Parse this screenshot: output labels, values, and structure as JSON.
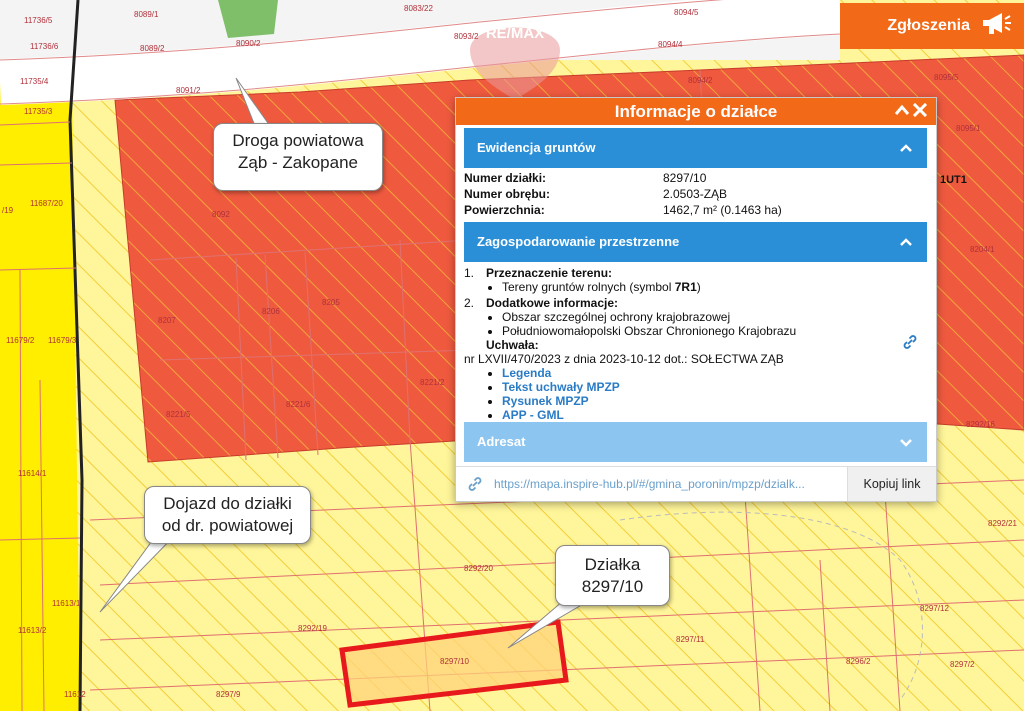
{
  "map": {
    "parcels": [
      {
        "label": "11736/5"
      },
      {
        "label": "11736/6"
      },
      {
        "label": "11735/4"
      },
      {
        "label": "11735/3"
      },
      {
        "label": "11687/20"
      },
      {
        "label": "11679/2"
      },
      {
        "label": "11679/3"
      },
      {
        "label": "11614/1"
      },
      {
        "label": "11613/1"
      },
      {
        "label": "11613/2"
      },
      {
        "label": "11612"
      },
      {
        "label": "/19"
      },
      {
        "label": "8089/1"
      },
      {
        "label": "8089/2"
      },
      {
        "label": "8090/2"
      },
      {
        "label": "8083/22"
      },
      {
        "label": "8093/2"
      },
      {
        "label": "8094/5"
      },
      {
        "label": "8094/4"
      },
      {
        "label": "8091/2"
      },
      {
        "label": "8094/2"
      },
      {
        "label": "8095/5"
      },
      {
        "label": "8095/1"
      },
      {
        "label": "8204/1"
      },
      {
        "label": "8092"
      },
      {
        "label": "8207"
      },
      {
        "label": "8206"
      },
      {
        "label": "8205"
      },
      {
        "label": "8221/5"
      },
      {
        "label": "8221/6"
      },
      {
        "label": "8221/2"
      },
      {
        "label": "8292/16"
      },
      {
        "label": "8292/21"
      },
      {
        "label": "8292/20"
      },
      {
        "label": "8292/19"
      },
      {
        "label": "8297/12"
      },
      {
        "label": "8297/11"
      },
      {
        "label": "8297/10"
      },
      {
        "label": "8296/2"
      },
      {
        "label": "8297/2"
      },
      {
        "label": "8297/9"
      }
    ],
    "zone_label": "1UT1",
    "watermark": "RE/MAX",
    "callouts": {
      "road": {
        "line1": "Droga powiatowa",
        "line2": "Ząb - Zakopane"
      },
      "access": {
        "line1": "Dojazd do działki",
        "line2": "od dr. powiatowej"
      },
      "plot": {
        "line1": "Działka",
        "line2": "8297/10"
      }
    }
  },
  "report_button": {
    "label": "Zgłoszenia",
    "icon": "megaphone-icon"
  },
  "popup": {
    "title": "Informacje o działce",
    "sections": {
      "ewidencja": {
        "title": "Ewidencja gruntów",
        "rows": [
          {
            "key": "Numer działki:",
            "value": "8297/10"
          },
          {
            "key": "Numer obrębu:",
            "value": "2.0503-ZĄB"
          },
          {
            "key": "Powierzchnia:",
            "value": "1462,7 m² (0.1463 ha)"
          }
        ]
      },
      "zagospodarowanie": {
        "title": "Zagospodarowanie przestrzenne",
        "item1": {
          "num": "1.",
          "title": "Przeznaczenie terenu:",
          "bullet_prefix": "Tereny gruntów rolnych (symbol ",
          "bullet_symbol": "7R1",
          "bullet_suffix": ")"
        },
        "item2": {
          "num": "2.",
          "title": "Dodatkowe informacje:",
          "bullets": [
            "Obszar szczególnej ochrony krajobrazowej",
            "Południowomałopolski Obszar Chronionego Krajobrazu"
          ],
          "resolution_label": "Uchwała:",
          "resolution_text": "nr LXVII/470/2023 z dnia 2023-10-12 dot.: SOŁECTWA ZĄB",
          "links": [
            "Legenda",
            "Tekst uchwały MPZP",
            "Rysunek MPZP",
            "APP - GML"
          ]
        }
      },
      "adresat": {
        "title": "Adresat"
      }
    },
    "share_url": "https://mapa.inspire-hub.pl/#/gmina_poronin/mpzp/dzialk...",
    "copy_label": "Kopiuj link"
  },
  "colors": {
    "orange": "#f26a18",
    "section_blue": "#2b8fd8",
    "section_light_blue": "#8cc5f0",
    "link_blue": "#2a7bc6",
    "plot_red": "#e8191c",
    "zone_red": "#ef5a3f",
    "agri_yellow": "#fff59a",
    "road_yellow": "#ffee00"
  }
}
